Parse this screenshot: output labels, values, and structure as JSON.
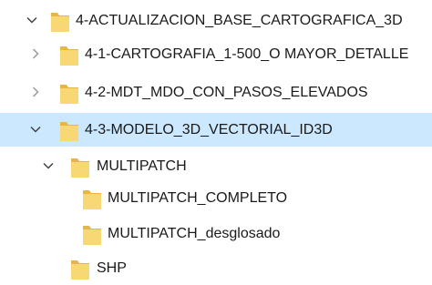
{
  "tree": {
    "nodes": [
      {
        "label": "4-ACTUALIZACION_BASE_CARTOGRAFICA_3D",
        "expander": "expanded",
        "selected": false,
        "icon": "folder-icon"
      },
      {
        "label": "4-1-CARTOGRAFIA_1-500_O MAYOR_DETALLE",
        "expander": "collapsed",
        "selected": false,
        "icon": "folder-icon"
      },
      {
        "label": "4-2-MDT_MDO_CON_PASOS_ELEVADOS",
        "expander": "collapsed",
        "selected": false,
        "icon": "folder-icon"
      },
      {
        "label": "4-3-MODELO_3D_VECTORIAL_ID3D",
        "expander": "expanded",
        "selected": true,
        "icon": "folder-icon"
      },
      {
        "label": "MULTIPATCH",
        "expander": "expanded",
        "selected": false,
        "icon": "folder-icon"
      },
      {
        "label": "MULTIPATCH_COMPLETO",
        "expander": "none",
        "selected": false,
        "icon": "folder-icon"
      },
      {
        "label": "MULTIPATCH_desglosado",
        "expander": "none",
        "selected": false,
        "icon": "folder-icon"
      },
      {
        "label": "SHP",
        "expander": "none",
        "selected": false,
        "icon": "folder-icon"
      }
    ]
  },
  "colors": {
    "selection": "#cce8ff",
    "folder_body": "#f8d775",
    "folder_tab": "#e8b645",
    "chevron": "#444444"
  }
}
